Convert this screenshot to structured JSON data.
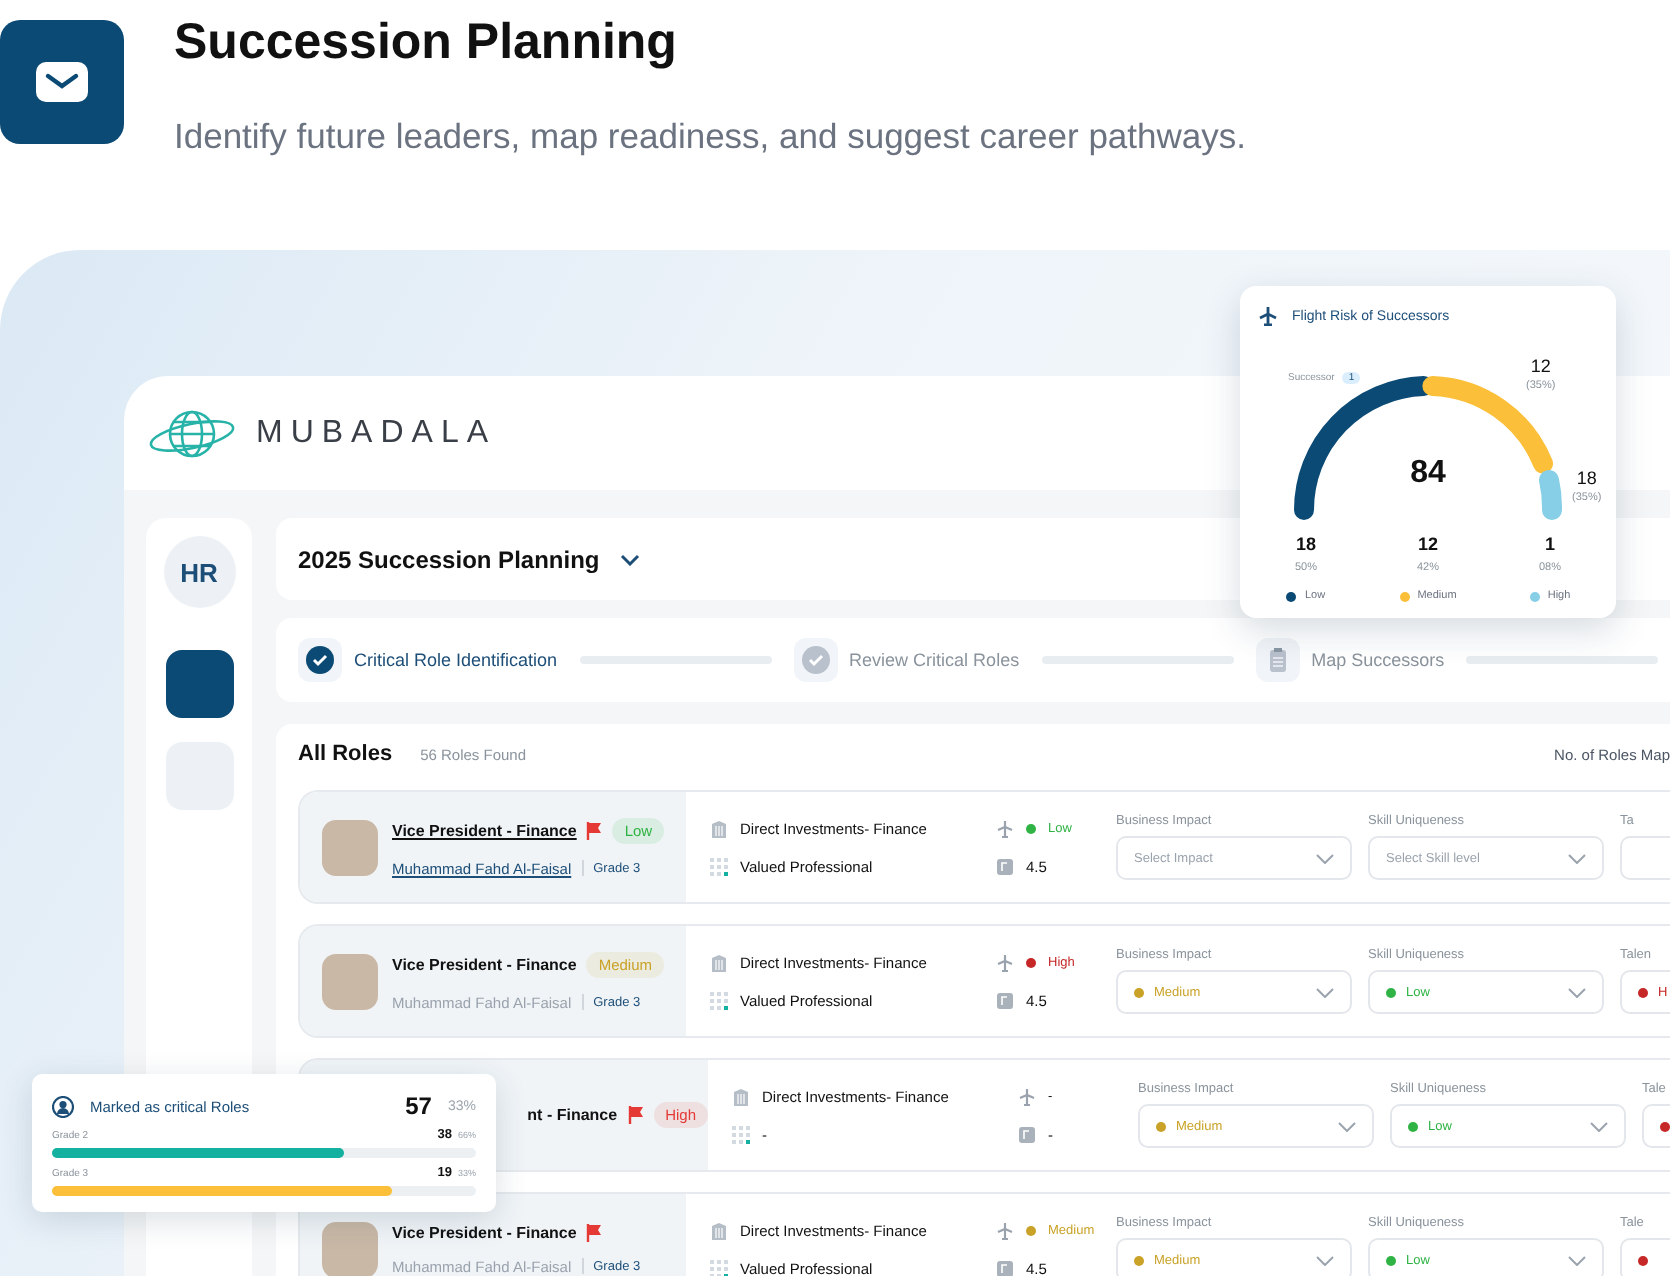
{
  "header": {
    "title": "Succession Planning",
    "subtitle": "Identify future leaders, map readiness, and suggest career pathways."
  },
  "app": {
    "brand": "MUBADALA",
    "user_initials": "HR",
    "nav": [
      {
        "selected": true
      },
      {
        "selected": false
      }
    ],
    "plan_selector": {
      "value": "2025 Succession Planning"
    },
    "steps": [
      {
        "label": "Critical Role Identification",
        "kind": "current"
      },
      {
        "label": "Review Critical Roles",
        "kind": "done"
      },
      {
        "label": "Map Successors",
        "kind": "todo"
      }
    ],
    "roles": {
      "title": "All Roles",
      "count": "56 Roles Found",
      "column_right": "No. of Roles Map",
      "rows": [
        {
          "title": "Vice President - Finance",
          "flagged": true,
          "risk": {
            "text": "Low",
            "color": "#2fb344"
          },
          "name": "Muhammad Fahd Al-Faisal",
          "grade": "Grade 3",
          "highlighted": true,
          "department": "Direct Investments- Finance",
          "flight_risk": {
            "text": "Low",
            "color": "#2fb344"
          },
          "category": "Valued Professional",
          "rating": "4.5",
          "fields": [
            {
              "label": "Business Impact",
              "placeholder": "Select Impact"
            },
            {
              "label": "Skill Uniqueness",
              "placeholder": "Select Skill level"
            },
            {
              "label": "Ta"
            }
          ]
        },
        {
          "title": "Vice President - Finance",
          "flagged": false,
          "risk": {
            "text": "Medium",
            "color": "#c9a227"
          },
          "name": "Muhammad Fahd Al-Faisal",
          "grade": "Grade 3",
          "highlighted": false,
          "department": "Direct Investments- Finance",
          "flight_risk": {
            "text": "High",
            "color": "#c62828"
          },
          "category": "Valued Professional",
          "rating": "4.5",
          "fields": [
            {
              "label": "Business Impact",
              "value": "Medium",
              "color": "#c9a227"
            },
            {
              "label": "Skill Uniqueness",
              "value": "Low",
              "color": "#2fb344"
            },
            {
              "label": "Talen",
              "value": "H",
              "color": "#c62828"
            }
          ]
        },
        {
          "title": "nt - Finance",
          "flagged": true,
          "risk": {
            "text": "High",
            "color": "#e53935"
          },
          "department": "Direct Investments- Finance",
          "flight_risk": {
            "text": "-"
          },
          "category": "-",
          "rating": "-",
          "fields": [
            {
              "label": "Business Impact",
              "value": "Medium",
              "color": "#c9a227"
            },
            {
              "label": "Skill Uniqueness",
              "value": "Low",
              "color": "#2fb344"
            },
            {
              "label": "Tale",
              "color": "#c62828"
            }
          ]
        },
        {
          "title": "Vice President - Finance",
          "flagged": true,
          "name": "Muhammad Fahd Al-Faisal",
          "grade": "Grade 3",
          "highlighted": false,
          "department": "Direct Investments- Finance",
          "flight_risk": {
            "text": "Medium",
            "color": "#c9a227"
          },
          "category": "Valued Professional",
          "rating": "4.5",
          "fields": [
            {
              "label": "Business Impact",
              "value": "Medium",
              "color": "#c9a227"
            },
            {
              "label": "Skill Uniqueness",
              "value": "Low",
              "color": "#2fb344"
            },
            {
              "label": "Tale",
              "color": "#c62828"
            }
          ]
        }
      ]
    }
  },
  "flight_risk_card": {
    "title": "Flight Risk of Successors",
    "successor_label": "Successor",
    "successor_count": "1",
    "total": "84",
    "arc_labels": [
      {
        "value": "12",
        "share": "(35%)"
      },
      {
        "value": "18",
        "share": "(35%)"
      }
    ],
    "stats": [
      {
        "value": "18",
        "share": "50%",
        "label": "Low",
        "color": "#0b4a74"
      },
      {
        "value": "12",
        "share": "42%",
        "label": "Medium",
        "color": "#fbbf3a"
      },
      {
        "value": "1",
        "share": "08%",
        "label": "High",
        "color": "#86cfe6"
      }
    ]
  },
  "critical_card": {
    "title": "Marked as critical Roles",
    "total": "57",
    "share": "33%",
    "grades": [
      {
        "label": "Grade 2",
        "count": "38",
        "share": "66%",
        "level": 0.69,
        "color": "#14b0a0"
      },
      {
        "label": "Grade 3",
        "count": "19",
        "share": "33%",
        "level": 0.8,
        "color": "#fbbf3a"
      }
    ]
  }
}
